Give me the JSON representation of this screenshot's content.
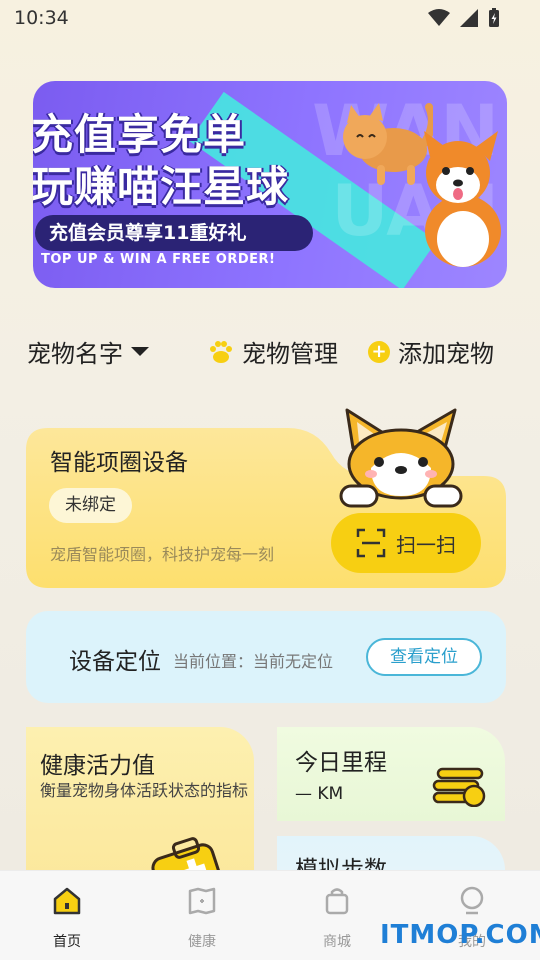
{
  "status": {
    "time": "10:34"
  },
  "banner": {
    "line1": "充值享免单",
    "line2": "玩赚喵汪星球",
    "pill": "充值会员尊享11重好礼",
    "english": "TOP UP & WIN A FREE ORDER!",
    "watermark1": "WAN",
    "watermark2": "UAN"
  },
  "pet_row": {
    "name_label": "宠物名字",
    "manage_label": "宠物管理",
    "add_label": "添加宠物"
  },
  "collar_card": {
    "title": "智能项圈设备",
    "badge": "未绑定",
    "desc": "宠盾智能项圈，科技护宠每一刻",
    "scan_label": "扫一扫"
  },
  "location_card": {
    "title": "设备定位",
    "desc": "当前位置：当前无定位",
    "button": "查看定位"
  },
  "health_card": {
    "title": "健康活力值",
    "desc": "衡量宠物身体活跃状态的指标"
  },
  "mileage_card": {
    "title": "今日里程",
    "value": "— KM"
  },
  "steps_card": {
    "title": "模拟步数"
  },
  "tabs": [
    {
      "label": "首页",
      "icon": "home-icon"
    },
    {
      "label": "健康",
      "icon": "health-icon"
    },
    {
      "label": "商城",
      "icon": "shop-icon"
    },
    {
      "label": "我的",
      "icon": "profile-icon"
    }
  ],
  "site_watermark": "ITMOP.COM",
  "colors": {
    "accent_yellow": "#f7cf12",
    "banner_purple": "#8e74ff",
    "location_blue": "#2a9fcc"
  }
}
